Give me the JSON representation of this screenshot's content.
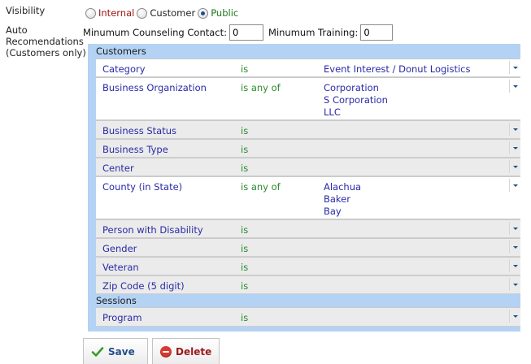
{
  "labels": {
    "visibility": "Visibility",
    "auto_line1": "Auto",
    "auto_line2": "Recomendations",
    "auto_line3": "(Customers only)"
  },
  "visibility_options": {
    "internal": "Internal",
    "customer": "Customer",
    "public": "Public",
    "selected": "Public"
  },
  "minimums": {
    "counseling_label": "Minumum Counseling Contact:",
    "counseling_value": "0",
    "training_label": "Minumum Training:",
    "training_value": "0"
  },
  "customers": {
    "header": "Customers",
    "rows": [
      {
        "field": "Category",
        "op": "is",
        "values": [
          "Event Interest / Donut Logistics"
        ]
      },
      {
        "field": "Business Organization",
        "op": "is any of",
        "values": [
          "Corporation",
          "S Corporation",
          "LLC"
        ]
      },
      {
        "field": "Business Status",
        "op": "is",
        "values": []
      },
      {
        "field": "Business Type",
        "op": "is",
        "values": []
      },
      {
        "field": "Center",
        "op": "is",
        "values": []
      },
      {
        "field": "County (in State)",
        "op": "is any of",
        "values": [
          "Alachua",
          "Baker",
          "Bay"
        ]
      },
      {
        "field": "Person with Disability",
        "op": "is",
        "values": []
      },
      {
        "field": "Gender",
        "op": "is",
        "values": []
      },
      {
        "field": "Veteran",
        "op": "is",
        "values": []
      },
      {
        "field": "Zip Code (5 digit)",
        "op": "is",
        "values": []
      }
    ]
  },
  "sessions": {
    "header": "Sessions",
    "rows": [
      {
        "field": "Program",
        "op": "is",
        "values": []
      }
    ]
  },
  "buttons": {
    "save": "Save",
    "delete": "Delete"
  }
}
